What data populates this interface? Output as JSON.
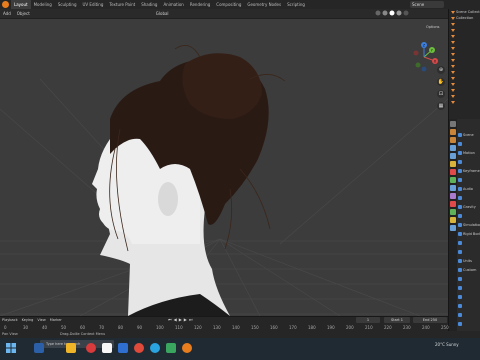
{
  "workspace_tabs": [
    "Layout",
    "Modeling",
    "Sculpting",
    "UV Editing",
    "Texture Paint",
    "Shading",
    "Animation",
    "Rendering",
    "Compositing",
    "Geometry Nodes",
    "Scripting"
  ],
  "active_tab_index": 0,
  "scene_name": "Scene",
  "header": {
    "menu_add": "Add",
    "menu_object": "Object",
    "transform_orientation": "Global",
    "options_label": "Options"
  },
  "gizmo": {
    "x": "X",
    "y": "Y",
    "z": "Z"
  },
  "outliner": {
    "title": "Scene Collection",
    "items": [
      "Scene Collection",
      "Collection",
      "",
      "",
      "",
      "",
      "",
      "",
      "",
      "",
      "",
      "",
      "",
      "",
      "",
      ""
    ]
  },
  "properties": {
    "title": "Scene",
    "rows": [
      "Scene",
      "",
      "Motion",
      "",
      "Keyframe",
      "",
      "Audio",
      "",
      "Gravity",
      "",
      "Simulation",
      "Rigid Body",
      "",
      "",
      "Units",
      "Custom",
      "",
      "",
      "",
      "",
      "",
      ""
    ]
  },
  "timeline": {
    "menu_playback": "Playback",
    "menu_keying": "Keying",
    "menu_view": "View",
    "menu_marker": "Marker",
    "current_frame": "1",
    "start_label": "Start",
    "start_value": "1",
    "end_label": "End",
    "end_value": "250",
    "ruler_ticks": [
      "0",
      "30",
      "40",
      "50",
      "60",
      "70",
      "80",
      "90",
      "100",
      "110",
      "120",
      "130",
      "140",
      "150",
      "160",
      "170",
      "180",
      "190",
      "200",
      "210",
      "220",
      "230",
      "240",
      "250"
    ]
  },
  "statusbar": {
    "left": "Pan View",
    "center": "Drag-Dollie Context Menu"
  },
  "taskbar": {
    "search_placeholder": "Type here to search",
    "weather": "20°C Sunny"
  },
  "colors": {
    "viewport_bg": "#3c3c3c",
    "accent_orange": "#e48a3c",
    "check_blue": "#4a8ad8",
    "x_axis": "#d84a4a",
    "y_axis": "#6cbf3c",
    "z_axis": "#3c7fe0"
  }
}
